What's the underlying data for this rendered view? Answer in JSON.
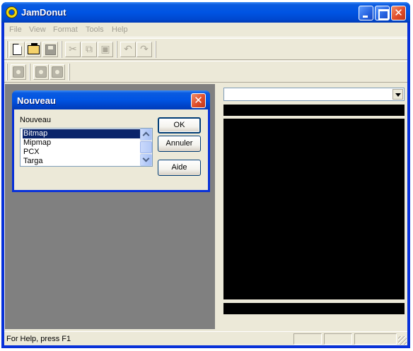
{
  "window": {
    "title": "JamDonut",
    "minimize_glyph": "",
    "maximize_glyph": "",
    "close_glyph": "✕"
  },
  "menu": {
    "items": [
      "File",
      "View",
      "Format",
      "Tools",
      "Help"
    ]
  },
  "toolbar1": {
    "icons": [
      "new-file-icon",
      "open-folder-icon",
      "save-icon",
      "cut-icon",
      "copy-icon",
      "paste-icon",
      "undo-icon",
      "redo-icon"
    ],
    "glyphs": {
      "cut": "✂",
      "copy": "⧉",
      "paste": "▣",
      "undo": "↶",
      "redo": "↷"
    }
  },
  "toolbar2": {
    "icons": [
      "tool-icon-1",
      "tool-icon-2",
      "tool-icon-3"
    ]
  },
  "dialog": {
    "title": "Nouveau",
    "close_glyph": "✕",
    "label": "Nouveau",
    "list_items": [
      "Bitmap",
      "Mipmap",
      "PCX",
      "Targa"
    ],
    "selected_index": 0,
    "ok_label": "OK",
    "cancel_label": "Annuler",
    "help_label": "Aide"
  },
  "right_pane": {
    "combo_value": ""
  },
  "status": {
    "text": "For Help, press F1"
  },
  "colors": {
    "titlebar": "#0054e3",
    "mdi_background": "#808080",
    "preview_background": "#000000",
    "selection": "#0a246a"
  }
}
